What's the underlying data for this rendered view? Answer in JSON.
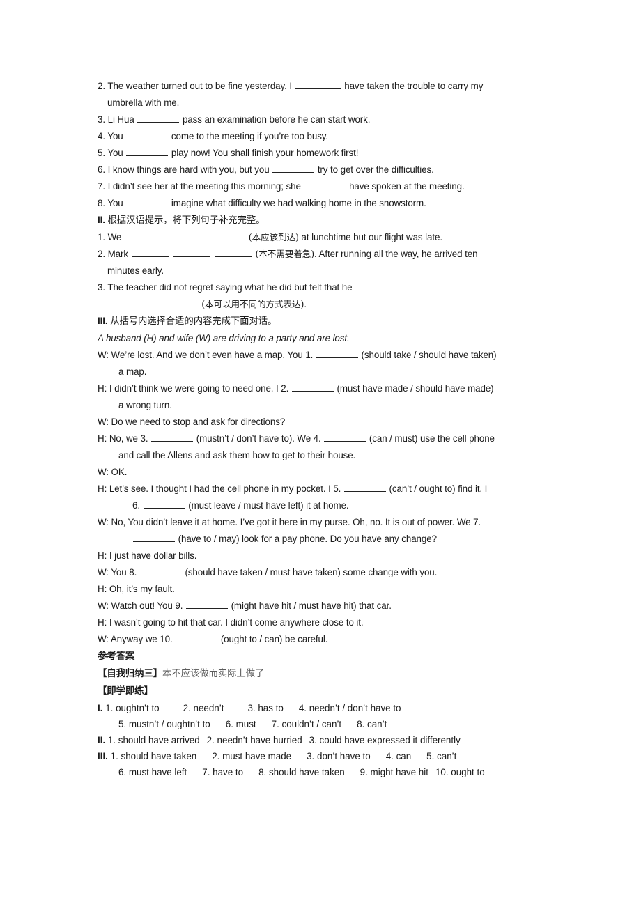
{
  "document": {
    "type": "worksheet",
    "subject": "English grammar exercises - modal verbs",
    "background_color": "#ffffff",
    "text_color": "#1a1a1a"
  },
  "section_one": {
    "items": [
      {
        "number": "2.",
        "part_a": "The weather turned out to be fine yesterday. I",
        "part_b": "have taken the trouble to carry my",
        "continuation": "umbrella with me."
      },
      {
        "number": "3.",
        "part_a": "Li Hua",
        "part_b": "pass an examination before he can start work."
      },
      {
        "number": "4.",
        "part_a": "You",
        "part_b": "come to the meeting if you’re too busy."
      },
      {
        "number": "5.",
        "part_a": "You",
        "part_b": "play now! You shall finish your homework first!"
      },
      {
        "number": "6.",
        "part_a": "I know things are hard with you, but you",
        "part_b": "try to get over the difficulties."
      },
      {
        "number": "7.",
        "part_a": "I didn’t see her at the meeting this morning; she",
        "part_b": "have spoken at the meeting."
      },
      {
        "number": "8.",
        "part_a": "You",
        "part_b": "imagine what difficulty we had walking home in the snowstorm."
      }
    ]
  },
  "section_two": {
    "roman": "II.",
    "heading_cn": "根据汉语提示，将下列句子补充完整。",
    "items": [
      {
        "number": "1.",
        "lead": "We",
        "hint": "(本应该到达)",
        "tail": "at lunchtime but our flight was late."
      },
      {
        "number": "2.",
        "lead": "Mark",
        "hint": "(本不需要着急)",
        "tail": ". After running all the way, he arrived ten",
        "continuation": "minutes early."
      },
      {
        "number": "3.",
        "lead": "The teacher did not regret saying what he did but felt that he",
        "hint": "(本可以用不同的方式表达)",
        "tail": "."
      }
    ]
  },
  "section_three": {
    "roman": "III.",
    "heading_cn": "从括号内选择合适的内容完成下面对话。",
    "scene": "A husband (H) and wife (W) are driving to a party and are lost.",
    "dialogue": [
      {
        "speaker": "W:",
        "line_a": "We’re lost. And we don’t even have a map. You 1.",
        "line_b": "(should take / should have taken)",
        "continuation": "a map."
      },
      {
        "speaker": "H:",
        "line_a": "I didn’t think we were going to need one. I 2.",
        "line_b": "(must have made / should have made)",
        "continuation": "a wrong turn."
      },
      {
        "speaker": "W:",
        "line_a": "Do we need to stop and ask for directions?"
      },
      {
        "speaker": "H:",
        "line_a": "No, we 3.",
        "line_b": "(mustn’t / don’t have to). We 4.",
        "line_c": "(can / must) use the cell phone",
        "continuation": "and call the Allens and ask them how to get to their house."
      },
      {
        "speaker": "W:",
        "line_a": "OK."
      },
      {
        "speaker": "H:",
        "line_a": "Let’s see. I thought I had the cell phone in my pocket. I 5.",
        "line_b": "(can’t / ought to) find it. I",
        "cont_number": "6.",
        "cont_b": "(must leave / must have left) it at home."
      },
      {
        "speaker": "W:",
        "line_a": "No, You didn’t leave it at home. I’ve got it here in my purse. Oh, no. It is out of power. We 7.",
        "cont_b": "(have to / may) look for a pay phone. Do you have any change?"
      },
      {
        "speaker": "H:",
        "line_a": "I just have dollar bills."
      },
      {
        "speaker": "W:",
        "line_a": "You 8.",
        "line_b": "(should have taken / must have taken) some change with you."
      },
      {
        "speaker": "H:",
        "line_a": "Oh, it’s my fault."
      },
      {
        "speaker": "W:",
        "line_a": "Watch out! You 9.",
        "line_b": "(might have hit / must have hit) that car."
      },
      {
        "speaker": "H:",
        "line_a": "I wasn’t going to hit that car. I didn’t come anywhere close to it."
      },
      {
        "speaker": "W:",
        "line_a": "Anyway we 10.",
        "line_b": "(ought to / can) be careful."
      }
    ]
  },
  "answer_key": {
    "title_cn": "参考答案",
    "summary_label_cn": "【自我归纳三】",
    "summary_value_cn": "本不应该做而实际上做了",
    "practice_label_cn": "【即学即练】",
    "group_one": {
      "roman": "I.",
      "row1": [
        "1. oughtn’t to",
        "2. needn’t",
        "3. has to",
        "4. needn’t / don’t have to"
      ],
      "row2": [
        "5. mustn’t / oughtn’t to",
        "6. must",
        "7. couldn’t / can’t",
        "8. can’t"
      ]
    },
    "group_two": {
      "roman": "II.",
      "row1": [
        "1. should have arrived",
        "2. needn’t have hurried",
        "3. could have expressed it differently"
      ]
    },
    "group_three": {
      "roman": "III.",
      "row1": [
        "1. should have taken",
        "2. must have made",
        "3. don’t have to",
        "4. can",
        "5. can’t"
      ],
      "row2": [
        "6. must have left",
        "7. have to",
        "8. should have taken",
        "9. might have hit",
        "10. ought to"
      ]
    }
  }
}
